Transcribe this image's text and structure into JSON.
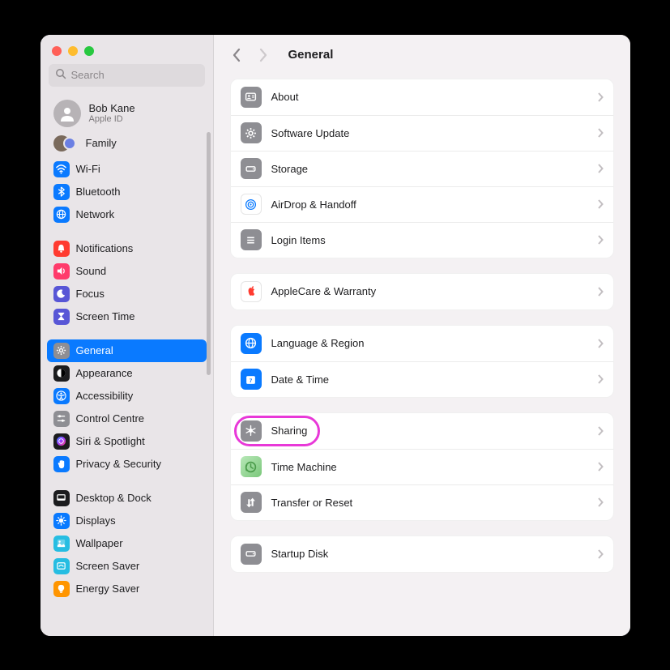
{
  "search": {
    "placeholder": "Search"
  },
  "account": {
    "name": "Bob Kane",
    "sub": "Apple ID"
  },
  "family": {
    "label": "Family"
  },
  "sidebar_groups": [
    [
      {
        "id": "wifi",
        "label": "Wi-Fi",
        "color": "#0a7aff",
        "icon": "wifi"
      },
      {
        "id": "bluetooth",
        "label": "Bluetooth",
        "color": "#0a7aff",
        "icon": "bluetooth"
      },
      {
        "id": "network",
        "label": "Network",
        "color": "#0a7aff",
        "icon": "globe"
      }
    ],
    [
      {
        "id": "notifications",
        "label": "Notifications",
        "color": "#ff3b30",
        "icon": "bell"
      },
      {
        "id": "sound",
        "label": "Sound",
        "color": "#ff3b6b",
        "icon": "speaker"
      },
      {
        "id": "focus",
        "label": "Focus",
        "color": "#5856d6",
        "icon": "moon"
      },
      {
        "id": "screentime",
        "label": "Screen Time",
        "color": "#5856d6",
        "icon": "hourglass"
      }
    ],
    [
      {
        "id": "general",
        "label": "General",
        "color": "#8e8e93",
        "icon": "gear",
        "selected": true
      },
      {
        "id": "appearance",
        "label": "Appearance",
        "color": "#1c1c1e",
        "icon": "appearance"
      },
      {
        "id": "accessibility",
        "label": "Accessibility",
        "color": "#0a7aff",
        "icon": "accessibility"
      },
      {
        "id": "controlcentre",
        "label": "Control Centre",
        "color": "#8e8e93",
        "icon": "sliders"
      },
      {
        "id": "siri",
        "label": "Siri & Spotlight",
        "color": "#1c1c1e",
        "icon": "siri"
      },
      {
        "id": "privacy",
        "label": "Privacy & Security",
        "color": "#0a7aff",
        "icon": "hand"
      }
    ],
    [
      {
        "id": "desktop",
        "label": "Desktop & Dock",
        "color": "#1c1c1e",
        "icon": "dock"
      },
      {
        "id": "displays",
        "label": "Displays",
        "color": "#0a7aff",
        "icon": "sun"
      },
      {
        "id": "wallpaper",
        "label": "Wallpaper",
        "color": "#26bde2",
        "icon": "wallpaper"
      },
      {
        "id": "screensaver",
        "label": "Screen Saver",
        "color": "#26bde2",
        "icon": "screensaver"
      },
      {
        "id": "energy",
        "label": "Energy Saver",
        "color": "#ff9500",
        "icon": "bulb"
      }
    ]
  ],
  "page_title": "General",
  "sections": [
    [
      {
        "id": "about",
        "label": "About",
        "color": "#8e8e93",
        "icon": "id"
      },
      {
        "id": "software",
        "label": "Software Update",
        "color": "#8e8e93",
        "icon": "gear"
      },
      {
        "id": "storage",
        "label": "Storage",
        "color": "#8e8e93",
        "icon": "disk"
      },
      {
        "id": "airdrop",
        "label": "AirDrop & Handoff",
        "color": "#ffffff",
        "icon": "airdrop",
        "iconStroke": "#0a7aff"
      },
      {
        "id": "login",
        "label": "Login Items",
        "color": "#8e8e93",
        "icon": "list"
      }
    ],
    [
      {
        "id": "applecare",
        "label": "AppleCare & Warranty",
        "color": "#ffffff",
        "icon": "apple",
        "iconFill": "#ff3b30"
      }
    ],
    [
      {
        "id": "language",
        "label": "Language & Region",
        "color": "#0a7aff",
        "icon": "globe"
      },
      {
        "id": "datetime",
        "label": "Date & Time",
        "color": "#0a7aff",
        "icon": "calendar"
      }
    ],
    [
      {
        "id": "sharing",
        "label": "Sharing",
        "color": "#8e8e93",
        "icon": "sharing",
        "highlighted": true
      },
      {
        "id": "timemachine",
        "label": "Time Machine",
        "color": "#8e8e93",
        "icon": "clock",
        "bg": "grad-green"
      },
      {
        "id": "transfer",
        "label": "Transfer or Reset",
        "color": "#8e8e93",
        "icon": "arrows"
      }
    ],
    [
      {
        "id": "startup",
        "label": "Startup Disk",
        "color": "#8e8e93",
        "icon": "disk"
      }
    ]
  ]
}
